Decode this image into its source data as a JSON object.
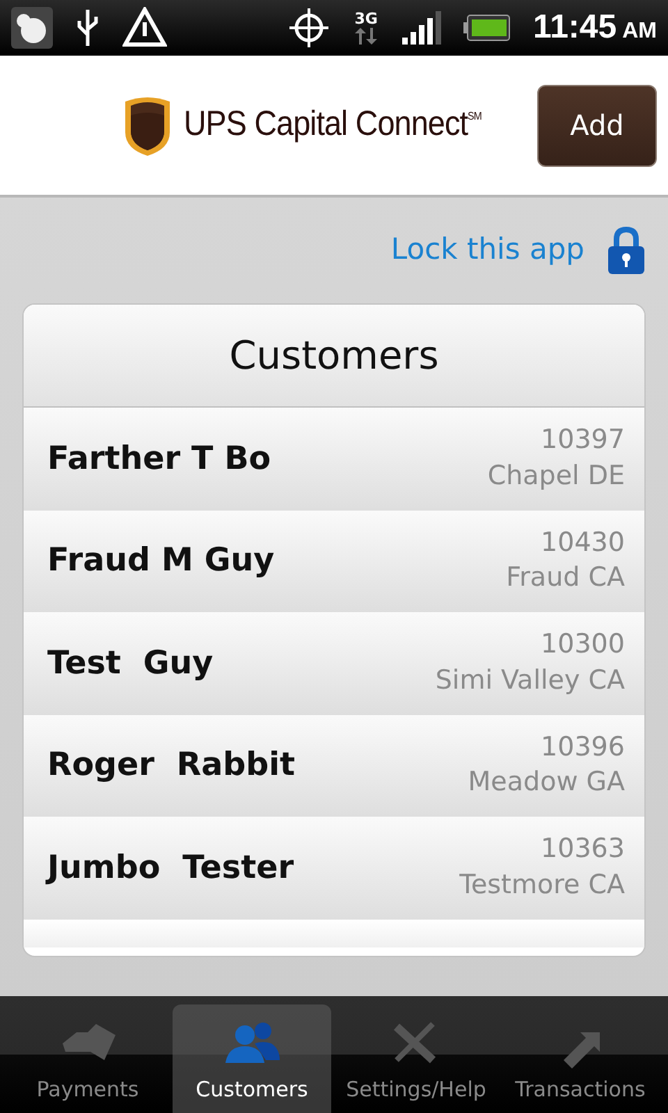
{
  "status_bar": {
    "network": "3G",
    "time": "11:45",
    "meridiem": "AM"
  },
  "header": {
    "brand": "UPS Capital Connect$^{SM}$",
    "button": "Add"
  },
  "lock_link": "Lock this app",
  "list": {
    "title": "Customers",
    "rows": [
      {
        "name": "Farther T Bo",
        "number": "10397",
        "place": "Chapel DE"
      },
      {
        "name": "Fraud M Guy",
        "number": "10430",
        "place": "Fraud CA"
      },
      {
        "name": "Test  Guy",
        "number": "10300",
        "place": "Simi Valley CA"
      },
      {
        "name": "Roger  Rabbit",
        "number": "10396",
        "place": "Meadow GA"
      },
      {
        "name": "Jumbo  Tester",
        "number": "10363",
        "place": "Testmore CA"
      }
    ]
  },
  "tabs": [
    {
      "kind": "payments",
      "label": "Payments",
      "selected": false
    },
    {
      "kind": "customers",
      "label": "Customers",
      "selected": true
    },
    {
      "kind": "settings",
      "label": "Settings/Help",
      "selected": false
    },
    {
      "kind": "transactions",
      "label": "Transactions",
      "selected": false
    }
  ]
}
